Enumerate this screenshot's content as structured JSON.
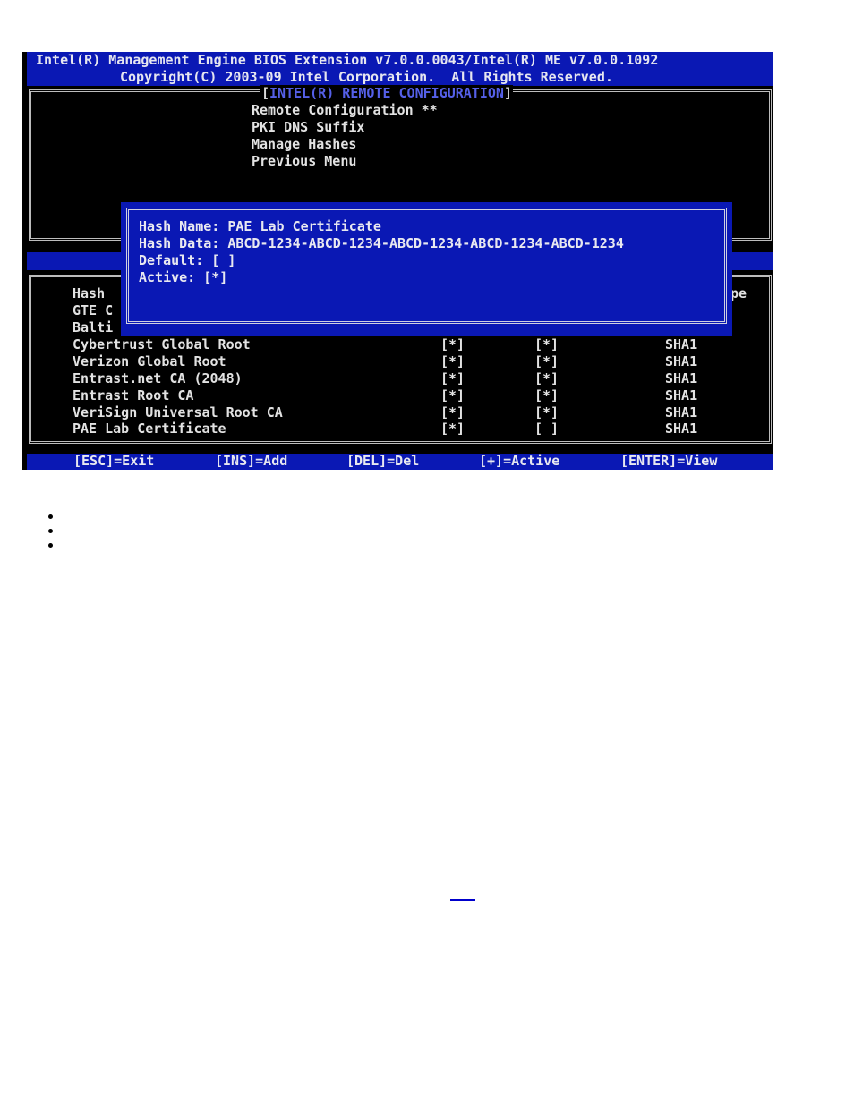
{
  "header": {
    "line1": "Intel(R) Management Engine BIOS Extension v7.0.0.0043/Intel(R) ME v7.0.0.1092",
    "line2": "Copyright(C) 2003-09 Intel Corporation.  All Rights Reserved."
  },
  "menu": {
    "title_open": "[",
    "title": "INTEL(R) REMOTE CONFIGURATION",
    "title_close": "]",
    "items": [
      {
        "label": "Remote Configuration **"
      },
      {
        "label": "PKI DNS Suffix"
      },
      {
        "label": "Manage Hashes"
      },
      {
        "label": "Previous Menu"
      }
    ]
  },
  "hash_table": {
    "partial_header_left": "Hash",
    "partial_header_right": "pe",
    "partial_rows": [
      "GTE C",
      "Balti"
    ],
    "rows": [
      {
        "name": "Cybertrust Global Root",
        "default": "[*]",
        "active": "[*]",
        "type": "SHA1"
      },
      {
        "name": "Verizon Global Root",
        "default": "[*]",
        "active": "[*]",
        "type": "SHA1"
      },
      {
        "name": "Entrast.net CA (2048)",
        "default": "[*]",
        "active": "[*]",
        "type": "SHA1"
      },
      {
        "name": "Entrast Root CA",
        "default": "[*]",
        "active": "[*]",
        "type": "SHA1"
      },
      {
        "name": "VeriSign Universal Root CA",
        "default": "[*]",
        "active": "[*]",
        "type": "SHA1"
      },
      {
        "name": "PAE Lab Certificate",
        "default": "[*]",
        "active": "[ ]",
        "type": "SHA1"
      }
    ]
  },
  "dialog": {
    "hash_name": "Hash Name: PAE Lab Certificate",
    "hash_data": "Hash Data: ABCD-1234-ABCD-1234-ABCD-1234-ABCD-1234-ABCD-1234",
    "default": "Default: [ ]",
    "active": "Active: [*]"
  },
  "footer": {
    "esc": "[ESC]=Exit",
    "ins": "[INS]=Add",
    "del": "[DEL]=Del",
    "plus": "[+]=Active",
    "enter": "[ENTER]=View"
  },
  "colors": {
    "bios_blue": "#0a18b4",
    "bios_black": "#000000",
    "title_blue": "#5560e8",
    "text_gray": "#e2e2e2"
  }
}
